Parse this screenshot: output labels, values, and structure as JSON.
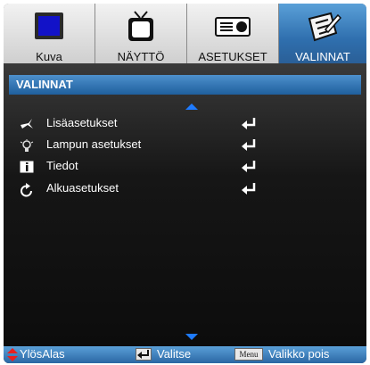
{
  "tabs": [
    {
      "label": "Kuva",
      "icon": "monitor-icon",
      "active": false
    },
    {
      "label": "NÄYTTÖ",
      "icon": "tv-icon",
      "active": false
    },
    {
      "label": "ASETUKSET",
      "icon": "projector-icon",
      "active": false
    },
    {
      "label": "VALINNAT",
      "icon": "document-edit-icon",
      "active": true
    }
  ],
  "section": {
    "title": "VALINNAT"
  },
  "items": [
    {
      "label": "Lisäasetukset",
      "icon": "star-icon"
    },
    {
      "label": "Lampun asetukset",
      "icon": "lamp-icon"
    },
    {
      "label": "Tiedot",
      "icon": "info-icon"
    },
    {
      "label": "Alkuasetukset",
      "icon": "reset-icon"
    }
  ],
  "footer": {
    "nav": "YlösAlas",
    "select": "Valitse",
    "menu_key": "Menu",
    "exit": "Valikko pois"
  },
  "colors": {
    "accent": "#2f6fae",
    "arrow": "#1e7bff"
  }
}
